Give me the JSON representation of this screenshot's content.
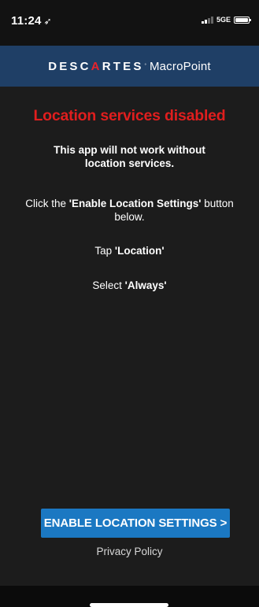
{
  "status_bar": {
    "time": "11:24",
    "location_icon": "location-arrow-icon",
    "network": "5GE",
    "signal_icon": "signal-bars-icon",
    "battery_icon": "battery-icon"
  },
  "header": {
    "brand_part1": "DESC",
    "brand_accent": "A",
    "brand_part2": "RTES",
    "brand_mark": "°",
    "product": "MacroPoint",
    "background_color": "#1f3f66",
    "accent_color": "#e8232c"
  },
  "main": {
    "headline": "Location services disabled",
    "headline_color": "#e01e1e",
    "warning": "This app will not work without location services.",
    "instruction1_prefix": "Click the ",
    "instruction1_bold": "'Enable Location Settings'",
    "instruction1_suffix": " button below.",
    "instruction2_prefix": "Tap ",
    "instruction2_bold": "'Location'",
    "instruction3_prefix": "Select ",
    "instruction3_bold": "'Always'"
  },
  "footer": {
    "enable_button_label": "ENABLE LOCATION SETTINGS >",
    "button_color": "#1b78c2",
    "privacy_link": "Privacy Policy"
  }
}
